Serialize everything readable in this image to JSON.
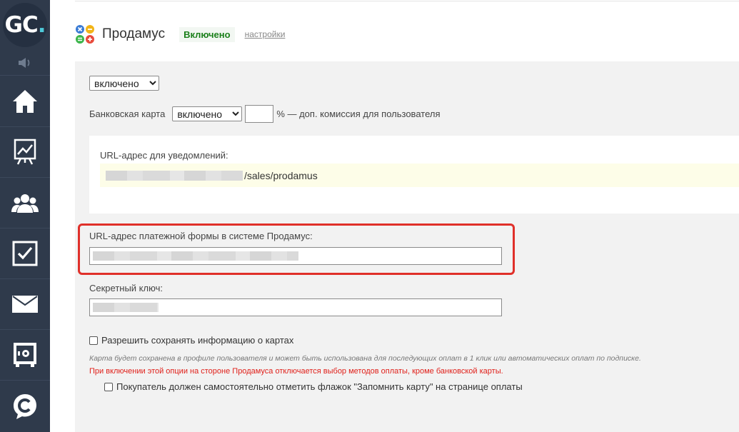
{
  "sidebar": {
    "logo_text": "GC",
    "logo_dot": ".",
    "items": [
      {
        "name": "sound-icon"
      },
      {
        "name": "home-icon"
      },
      {
        "name": "chart-icon"
      },
      {
        "name": "users-icon"
      },
      {
        "name": "tasks-icon"
      },
      {
        "name": "mail-icon"
      },
      {
        "name": "safe-icon"
      },
      {
        "name": "chat-icon"
      }
    ]
  },
  "header": {
    "title": "Продамус",
    "status": "Включено",
    "settings_link": "настройки"
  },
  "form": {
    "main_select": "включено",
    "bank_card_label": "Банковская карта",
    "bank_card_select": "включено",
    "commission_value": "",
    "commission_suffix": "% — доп. комиссия для пользователя",
    "notify_label": "URL-адрес для уведомлений:",
    "notify_url_suffix": "/sales/prodamus",
    "payment_form_label": "URL-адрес платежной формы в системе Продамус:",
    "secret_key_label": "Секретный ключ:",
    "save_cards_label": "Разрешить сохранять информацию о картах",
    "save_cards_note": "Карта будет сохранена в профиле пользователя и может быть использована для последующих оплат в 1 клик или автоматических оплат по подписке.",
    "save_cards_warning": "При включении этой опции на стороне Продамуса отключается выбор методов оплаты, кроме банковской карты.",
    "remember_card_label": "Покупатель должен самостоятельно отметить флажок \"Запомнить карту\" на странице оплаты"
  },
  "colors": {
    "sidebar_bg": "#2f3a4b",
    "status_green": "#1a7f1a",
    "highlight_red": "#e0302a",
    "warning_red": "#e0201a"
  }
}
